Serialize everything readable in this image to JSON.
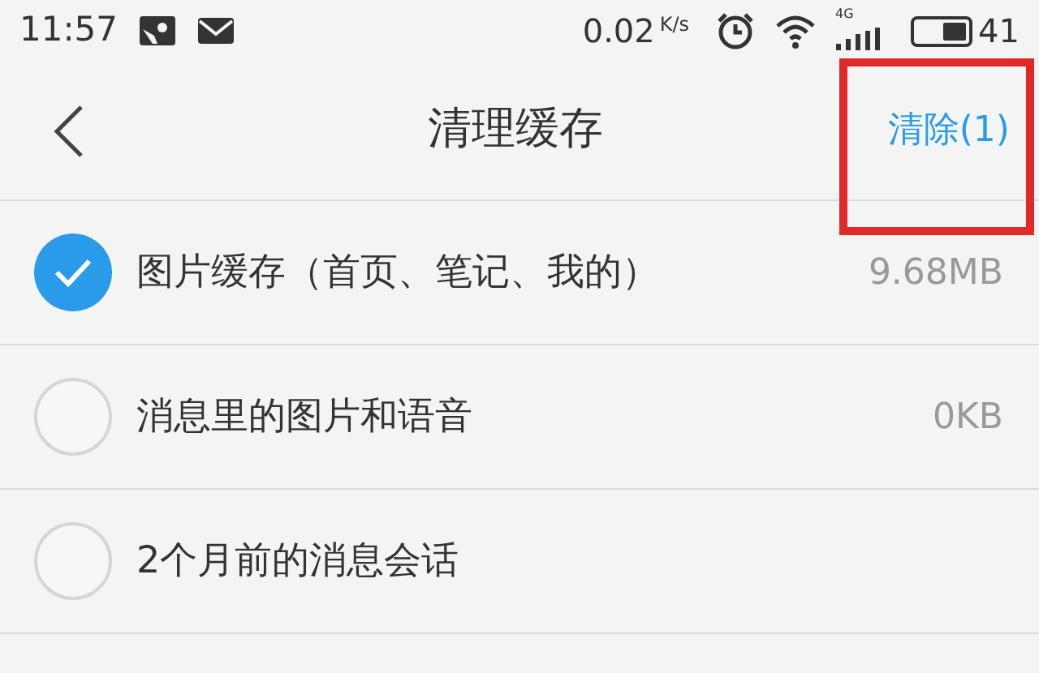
{
  "status_bar": {
    "time": "11:57",
    "speed": "0.02",
    "speed_unit": "K/s",
    "network": "4G",
    "battery": "41"
  },
  "header": {
    "title": "清理缓存",
    "action": "清除(1)"
  },
  "items": [
    {
      "label": "图片缓存（首页、笔记、我的）",
      "size": "9.68MB",
      "checked": true
    },
    {
      "label": "消息里的图片和语音",
      "size": "0KB",
      "checked": false
    },
    {
      "label": "2个月前的消息会话",
      "checked": false
    }
  ]
}
